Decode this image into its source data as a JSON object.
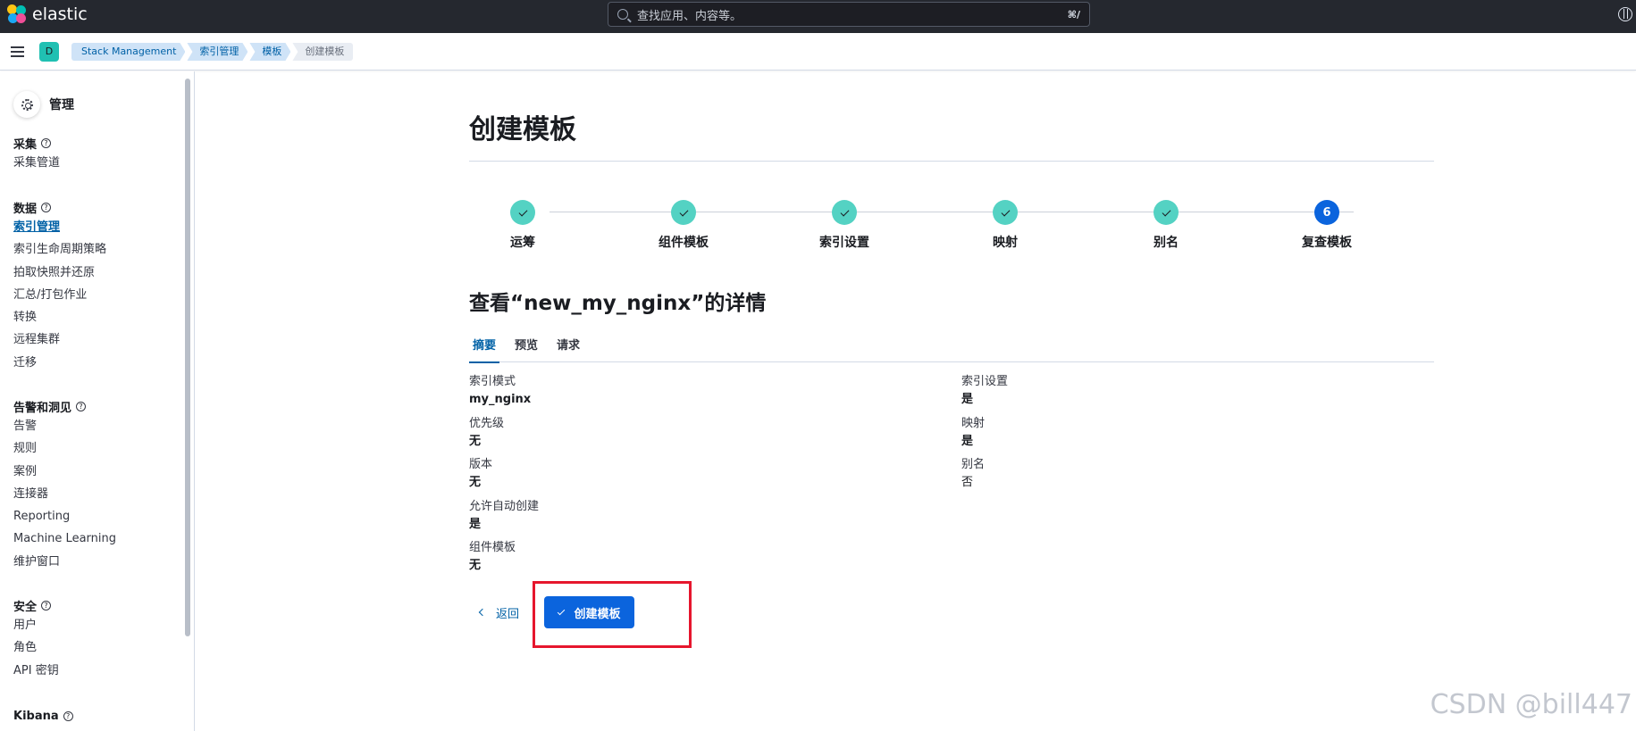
{
  "header": {
    "brand": "elastic",
    "search_placeholder": "查找应用、内容等。",
    "search_shortcut": "⌘/"
  },
  "space": {
    "initial": "D"
  },
  "breadcrumbs": [
    "Stack Management",
    "索引管理",
    "模板",
    "创建模板"
  ],
  "sidebar": {
    "title": "管理",
    "groups": [
      {
        "title": "采集",
        "items": [
          "采集管道"
        ]
      },
      {
        "title": "数据",
        "items": [
          "索引管理",
          "索引生命周期策略",
          "拍取快照并还原",
          "汇总/打包作业",
          "转换",
          "远程集群",
          "迁移"
        ]
      },
      {
        "title": "告警和洞见",
        "items": [
          "告警",
          "规则",
          "案例",
          "连接器",
          "Reporting",
          "Machine Learning",
          "维护窗口"
        ]
      },
      {
        "title": "安全",
        "items": [
          "用户",
          "角色",
          "API 密钥"
        ]
      },
      {
        "title": "Kibana",
        "items": []
      }
    ],
    "active_item": "索引管理"
  },
  "page": {
    "title": "创建模板",
    "steps": [
      {
        "label": "运筹",
        "state": "complete"
      },
      {
        "label": "组件模板",
        "state": "complete"
      },
      {
        "label": "索引设置",
        "state": "complete"
      },
      {
        "label": "映射",
        "state": "complete"
      },
      {
        "label": "别名",
        "state": "complete"
      },
      {
        "label": "复查模板",
        "state": "current",
        "number": "6"
      }
    ],
    "detail_title": "查看“new_my_nginx”的详情",
    "tabs": [
      "摘要",
      "预览",
      "请求"
    ],
    "selected_tab": "摘要",
    "summary_left": [
      {
        "label": "索引模式",
        "value": "my_nginx"
      },
      {
        "label": "优先级",
        "value": "无"
      },
      {
        "label": "版本",
        "value": "无"
      },
      {
        "label": "允许自动创建",
        "value": "是"
      },
      {
        "label": "组件模板",
        "value": "无"
      }
    ],
    "summary_right": [
      {
        "label": "索引设置",
        "value": "是"
      },
      {
        "label": "映射",
        "value": "是"
      },
      {
        "label": "别名",
        "value": "否"
      }
    ],
    "back_label": "返回",
    "create_label": "创建模板"
  },
  "watermark": "CSDN @bill447",
  "colors": {
    "topbar": "#25282f",
    "primary": "#0b64dd",
    "step_complete": "#54d2c3",
    "highlight": "#e6162d"
  }
}
